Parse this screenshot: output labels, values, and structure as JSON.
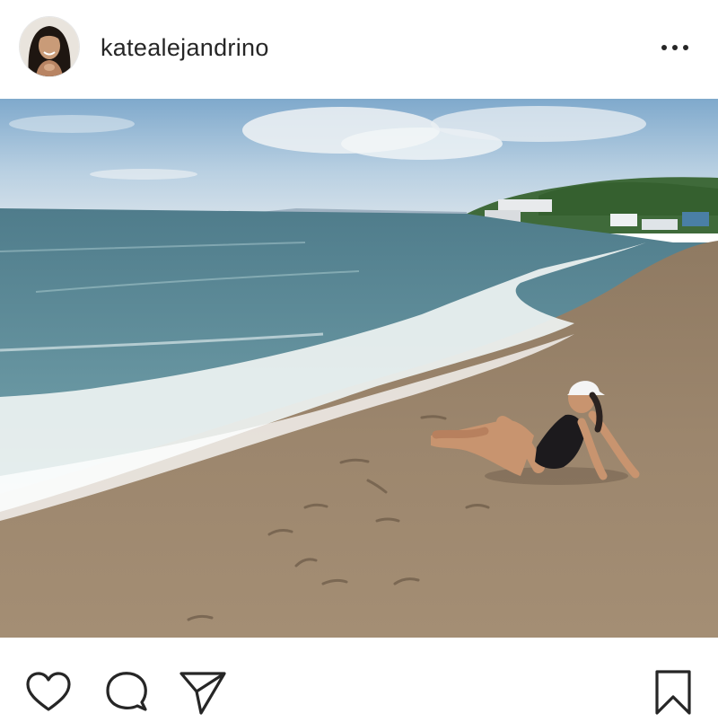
{
  "post": {
    "username": "katealejandrino",
    "more_icon": "more-horizontal-icon",
    "photo_description_icon": "beach-photo",
    "actions": {
      "like_icon": "heart-icon",
      "comment_icon": "comment-icon",
      "share_icon": "send-icon",
      "save_icon": "bookmark-icon"
    },
    "colors": {
      "text": "#262626",
      "icon": "#262626",
      "background": "#ffffff"
    }
  }
}
